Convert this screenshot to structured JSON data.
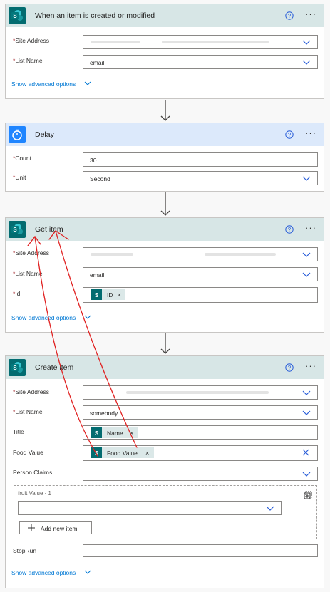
{
  "cards": {
    "trigger": {
      "title": "When an item is created or modified",
      "site_address_label": "Site Address",
      "list_name_label": "List Name",
      "list_name_value": "email",
      "advanced_label": "Show advanced options"
    },
    "delay": {
      "title": "Delay",
      "count_label": "Count",
      "count_value": "30",
      "unit_label": "Unit",
      "unit_value": "Second"
    },
    "get_item": {
      "title": "Get item",
      "site_address_label": "Site Address",
      "list_name_label": "List Name",
      "list_name_value": "email",
      "id_label": "Id",
      "id_token": "ID",
      "advanced_label": "Show advanced options"
    },
    "create_item": {
      "title": "Create item",
      "site_address_label": "Site Address",
      "list_name_label": "List Name",
      "list_name_value": "somebody",
      "title_label": "Title",
      "title_token": "Name",
      "food_value_label": "Food Value",
      "food_value_token": "Food Value",
      "person_claims_label": "Person Claims",
      "fruit_label": "fruit Value - 1",
      "add_new_item": "Add new item",
      "stoprun_label": "StopRun",
      "advanced_label": "Show advanced options"
    }
  },
  "required_mark": "*",
  "token_remove": "×",
  "more_menu": "···",
  "colors": {
    "sharepoint": "#036c70",
    "delay": "#1f85ff",
    "link": "#0078d4",
    "annotation": "#e02020"
  }
}
